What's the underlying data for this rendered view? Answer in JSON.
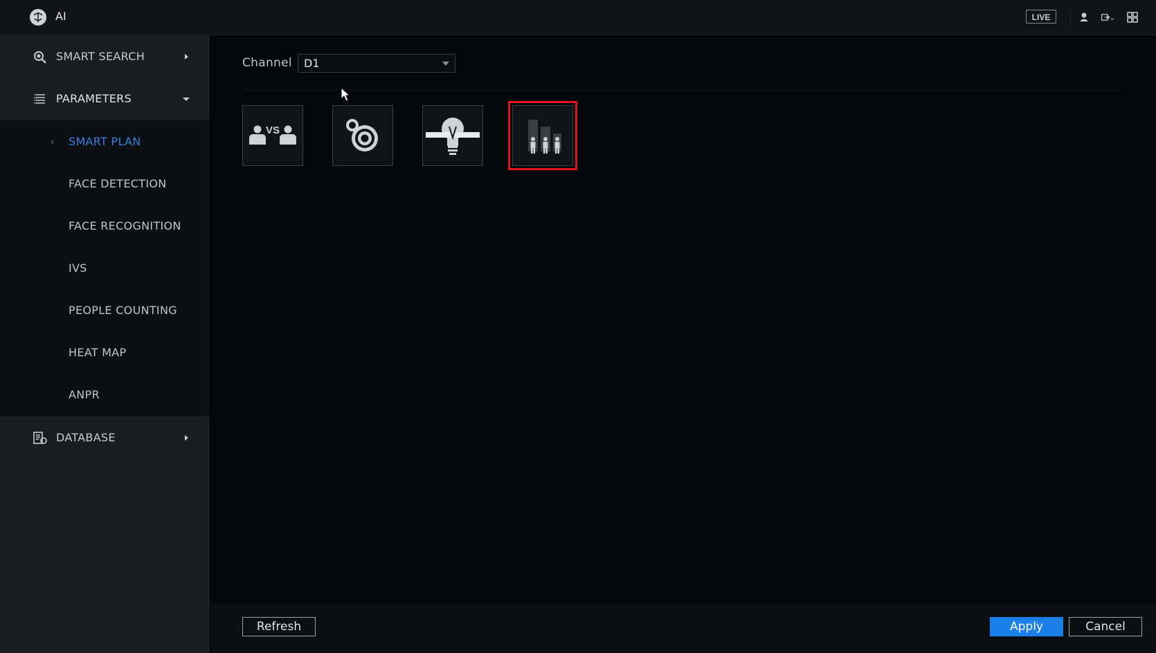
{
  "app": {
    "title": "AI",
    "live_label": "LIVE"
  },
  "sidebar": {
    "sections": [
      {
        "label": "SMART SEARCH",
        "icon": "smart-search-icon",
        "expanded": false
      },
      {
        "label": "PARAMETERS",
        "icon": "list-icon",
        "expanded": true
      },
      {
        "label": "DATABASE",
        "icon": "database-icon",
        "expanded": false
      }
    ],
    "parameters_items": [
      {
        "label": "SMART PLAN",
        "active": true
      },
      {
        "label": "FACE DETECTION",
        "active": false
      },
      {
        "label": "FACE RECOGNITION",
        "active": false
      },
      {
        "label": "IVS",
        "active": false
      },
      {
        "label": "PEOPLE COUNTING",
        "active": false
      },
      {
        "label": "HEAT MAP",
        "active": false
      },
      {
        "label": "ANPR",
        "active": false
      }
    ]
  },
  "main": {
    "channel_label": "Channel",
    "channel_value": "D1",
    "plans": [
      {
        "icon": "face-compare-icon",
        "selected": false
      },
      {
        "icon": "target-detect-icon",
        "selected": false
      },
      {
        "icon": "heat-bulb-icon",
        "selected": false
      },
      {
        "icon": "people-counting-icon",
        "selected": true
      }
    ]
  },
  "footer": {
    "refresh_label": "Refresh",
    "apply_label": "Apply",
    "cancel_label": "Cancel"
  },
  "colors": {
    "accent": "#1a7fe6",
    "active_text": "#3a7fe0",
    "selection_border": "#e0141a"
  }
}
